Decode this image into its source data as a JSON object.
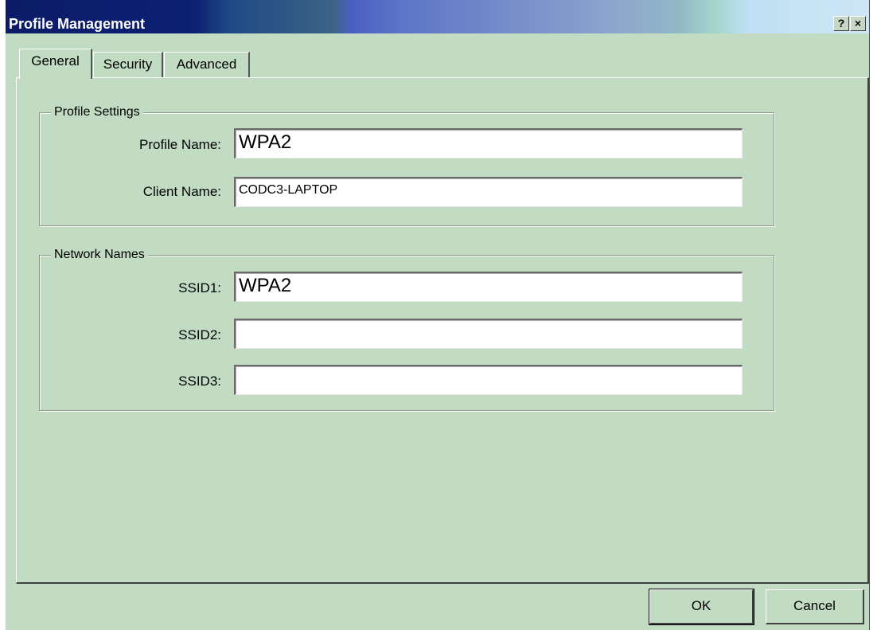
{
  "window": {
    "title": "Profile Management",
    "help_button": "?",
    "close_button": "×"
  },
  "tabs": [
    {
      "label": "General",
      "active": true
    },
    {
      "label": "Security",
      "active": false
    },
    {
      "label": "Advanced",
      "active": false
    }
  ],
  "profile_settings": {
    "group_title": "Profile Settings",
    "profile_name_label": "Profile Name:",
    "profile_name_value": "WPA2",
    "client_name_label": "Client Name:",
    "client_name_value": "CODC3-LAPTOP"
  },
  "network_names": {
    "group_title": "Network Names",
    "ssid1_label": "SSID1:",
    "ssid1_value": "WPA2",
    "ssid2_label": "SSID2:",
    "ssid2_value": "",
    "ssid3_label": "SSID3:",
    "ssid3_value": ""
  },
  "buttons": {
    "ok": "OK",
    "cancel": "Cancel"
  }
}
